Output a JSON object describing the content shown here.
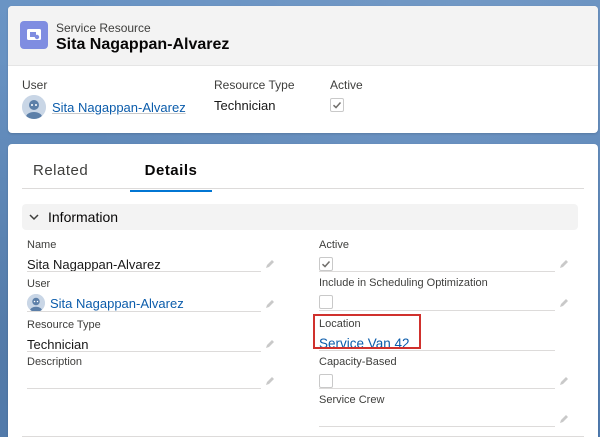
{
  "header": {
    "object_type": "Service Resource",
    "record_name": "Sita Nagappan-Alvarez",
    "fields": [
      {
        "label": "User",
        "value": "Sita Nagappan-Alvarez"
      },
      {
        "label": "Resource Type",
        "value": "Technician"
      },
      {
        "label": "Active",
        "checked": true
      }
    ]
  },
  "tabs": [
    {
      "label": "Related",
      "active": false
    },
    {
      "label": "Details",
      "active": true
    }
  ],
  "section": {
    "title": "Information"
  },
  "fields": {
    "name": {
      "label": "Name",
      "value": "Sita Nagappan-Alvarez"
    },
    "user": {
      "label": "User",
      "value": "Sita Nagappan-Alvarez"
    },
    "resource_type": {
      "label": "Resource Type",
      "value": "Technician"
    },
    "description": {
      "label": "Description",
      "value": ""
    },
    "active": {
      "label": "Active",
      "checked": true
    },
    "scheduling": {
      "label": "Include in Scheduling Optimization",
      "checked": false
    },
    "location": {
      "label": "Location",
      "value": "Service Van 42"
    },
    "capacity": {
      "label": "Capacity-Based",
      "checked": false
    },
    "service_crew": {
      "label": "Service Crew",
      "value": ""
    }
  },
  "colors": {
    "accent": "#0176d3",
    "link": "#0b5cab",
    "highlight": "#d0312d",
    "record_icon": "#7f8de1"
  },
  "icons": {
    "record": "service-resource-icon",
    "avatar": "user-avatar-icon",
    "edit": "pencil-icon",
    "chevron": "chevron-down-icon",
    "check": "check-icon"
  }
}
